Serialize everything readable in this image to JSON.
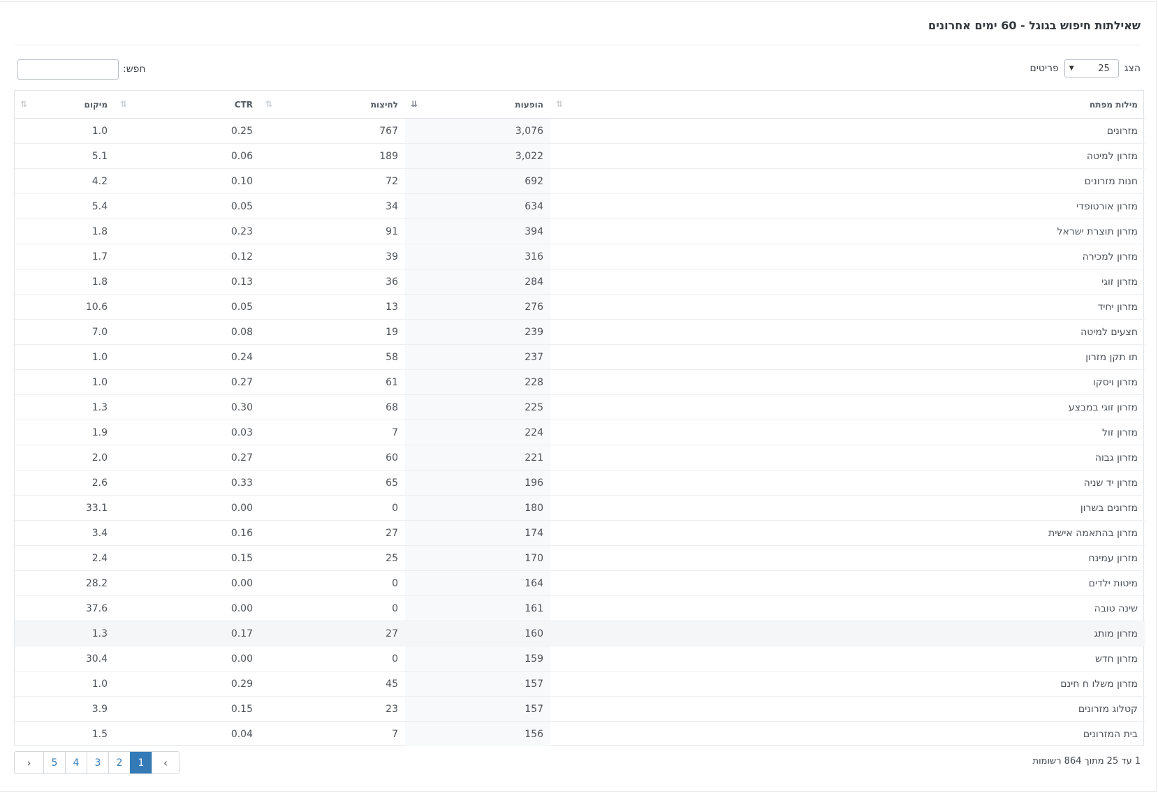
{
  "title": "שאילתות חיפוש בגוגל - 60 ימים אחרונים",
  "length_control": {
    "prefix": "הצג",
    "value": "25",
    "suffix": "פריטים"
  },
  "search": {
    "label": "חפש:",
    "value": ""
  },
  "columns": [
    {
      "label": "מילות מפתח",
      "sorted": false
    },
    {
      "label": "הופעות",
      "sorted": true,
      "direction": "desc"
    },
    {
      "label": "לחיצות",
      "sorted": false
    },
    {
      "label": "CTR",
      "sorted": false
    },
    {
      "label": "מיקום",
      "sorted": false
    }
  ],
  "rows": [
    [
      "מזרונים",
      "3,076",
      "767",
      "0.25",
      "1.0"
    ],
    [
      "מזרון למיטה",
      "3,022",
      "189",
      "0.06",
      "5.1"
    ],
    [
      "חנות מזרונים",
      "692",
      "72",
      "0.10",
      "4.2"
    ],
    [
      "מזרון אורטופדי",
      "634",
      "34",
      "0.05",
      "5.4"
    ],
    [
      "מזרון תוצרת ישראל",
      "394",
      "91",
      "0.23",
      "1.8"
    ],
    [
      "מזרון למכירה",
      "316",
      "39",
      "0.12",
      "1.7"
    ],
    [
      "מזרון זוגי",
      "284",
      "36",
      "0.13",
      "1.8"
    ],
    [
      "מזרון יחיד",
      "276",
      "13",
      "0.05",
      "10.6"
    ],
    [
      "חצעים למיטה",
      "239",
      "19",
      "0.08",
      "7.0"
    ],
    [
      "תו תקן מזרון",
      "237",
      "58",
      "0.24",
      "1.0"
    ],
    [
      "מזרון ויסקו",
      "228",
      "61",
      "0.27",
      "1.0"
    ],
    [
      "מזרון זוגי במבצע",
      "225",
      "68",
      "0.30",
      "1.3"
    ],
    [
      "מזרון זול",
      "224",
      "7",
      "0.03",
      "1.9"
    ],
    [
      "מזרון גבוה",
      "221",
      "60",
      "0.27",
      "2.0"
    ],
    [
      "מזרון יד שניה",
      "196",
      "65",
      "0.33",
      "2.6"
    ],
    [
      "מזרונים בשרון",
      "180",
      "0",
      "0.00",
      "33.1"
    ],
    [
      "מזרון בהתאמה אישית",
      "174",
      "27",
      "0.16",
      "3.4"
    ],
    [
      "מזרון עמינח",
      "170",
      "25",
      "0.15",
      "2.4"
    ],
    [
      "מיטות ילדים",
      "164",
      "0",
      "0.00",
      "28.2"
    ],
    [
      "שינה טובה",
      "161",
      "0",
      "0.00",
      "37.6"
    ],
    [
      "מזרון מותג",
      "160",
      "27",
      "0.17",
      "1.3"
    ],
    [
      "מזרון חדש",
      "159",
      "0",
      "0.00",
      "30.4"
    ],
    [
      "מזרון משלו ח חינם",
      "157",
      "45",
      "0.29",
      "1.0"
    ],
    [
      "קטלוג מזרונים",
      "157",
      "23",
      "0.15",
      "3.9"
    ],
    [
      "בית המזרונים",
      "156",
      "7",
      "0.04",
      "1.5"
    ]
  ],
  "highlighted_row": 20,
  "info": "1 עד 25 מתוך 864 רשומות",
  "pagination": {
    "prev": "‹",
    "next": "›",
    "pages": [
      "1",
      "2",
      "3",
      "4",
      "5"
    ],
    "active": "1"
  },
  "colors": {
    "accent": "#337ab7",
    "sorted_column_bg": "#f8f9fb"
  }
}
